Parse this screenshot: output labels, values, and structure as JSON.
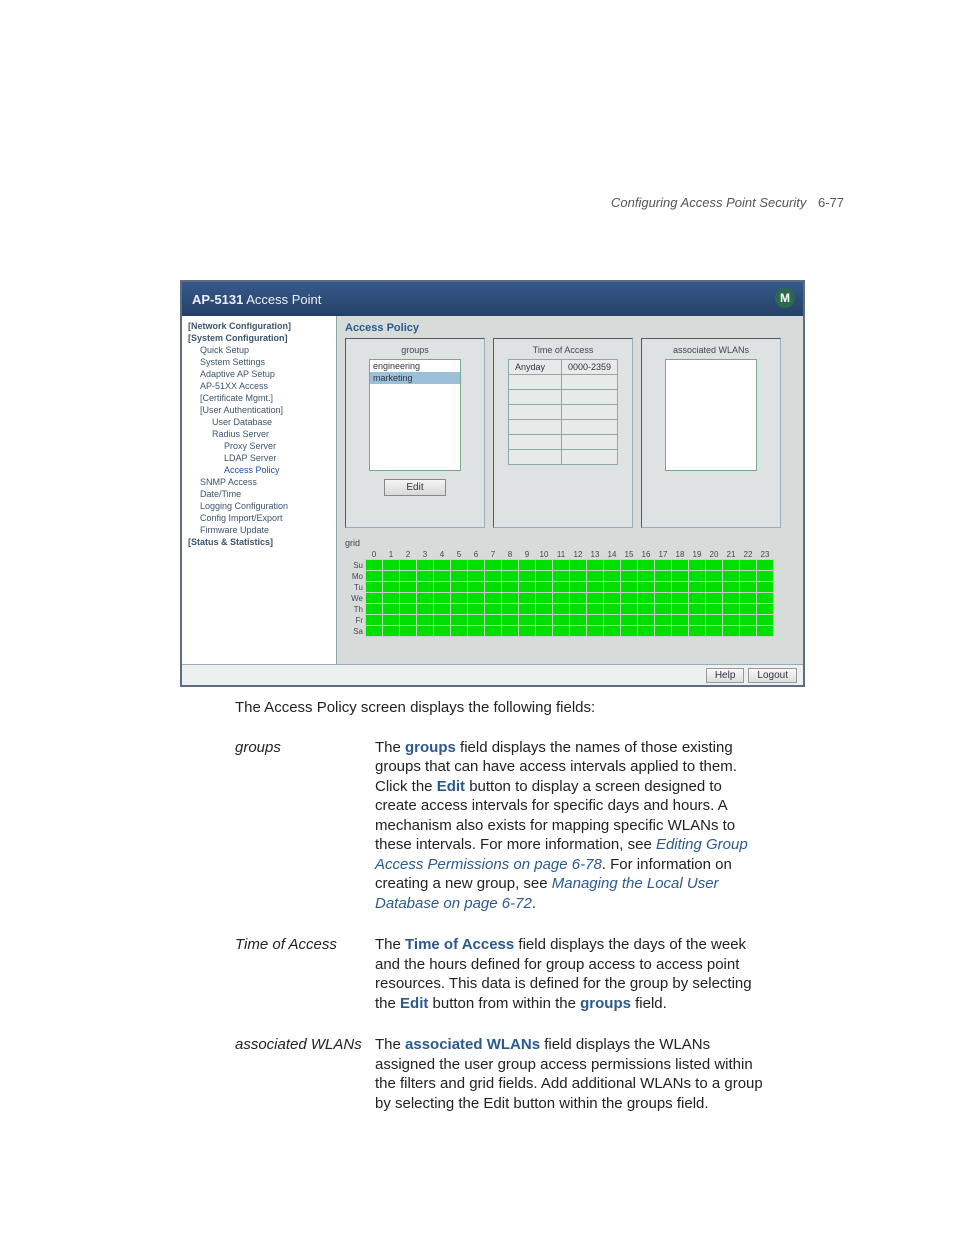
{
  "header": {
    "title": "Configuring Access Point Security",
    "page": "6-77"
  },
  "app": {
    "title_strong": "AP-5131",
    "title_rest": " Access Point",
    "logo_letter": "M",
    "nav": [
      {
        "label": "[Network Configuration]",
        "depth": 0
      },
      {
        "label": "[System Configuration]",
        "depth": 0
      },
      {
        "label": "Quick Setup",
        "depth": 1
      },
      {
        "label": "System Settings",
        "depth": 1
      },
      {
        "label": "Adaptive AP Setup",
        "depth": 1
      },
      {
        "label": "AP-51XX Access",
        "depth": 1
      },
      {
        "label": "[Certificate Mgmt.]",
        "depth": 1
      },
      {
        "label": "[User Authentication]",
        "depth": 1
      },
      {
        "label": "User Database",
        "depth": 2
      },
      {
        "label": "Radius Server",
        "depth": 2
      },
      {
        "label": "Proxy Server",
        "depth": 3
      },
      {
        "label": "LDAP Server",
        "depth": 3
      },
      {
        "label": "Access Policy",
        "depth": 3,
        "active": true
      },
      {
        "label": "SNMP Access",
        "depth": 1
      },
      {
        "label": "Date/Time",
        "depth": 1
      },
      {
        "label": "Logging Configuration",
        "depth": 1
      },
      {
        "label": "Config Import/Export",
        "depth": 1
      },
      {
        "label": "Firmware Update",
        "depth": 1
      },
      {
        "label": "[Status & Statistics]",
        "depth": 0
      }
    ],
    "main_title": "Access Policy",
    "panel_groups_label": "groups",
    "panel_time_label": "Time of Access",
    "panel_wlans_label": "associated WLANs",
    "groups_items": [
      "engineering",
      "marketing"
    ],
    "time_rows": [
      [
        "Anyday",
        "0000-2359"
      ],
      [
        "",
        ""
      ],
      [
        "",
        ""
      ],
      [
        "",
        ""
      ],
      [
        "",
        ""
      ],
      [
        "",
        ""
      ],
      [
        "",
        ""
      ]
    ],
    "edit_label": "Edit",
    "grid_label": "grid",
    "hours": [
      "0",
      "1",
      "2",
      "3",
      "4",
      "5",
      "6",
      "7",
      "8",
      "9",
      "10",
      "11",
      "12",
      "13",
      "14",
      "15",
      "16",
      "17",
      "18",
      "19",
      "20",
      "21",
      "22",
      "23"
    ],
    "days": [
      "Su",
      "Mo",
      "Tu",
      "We",
      "Th",
      "Fr",
      "Sa"
    ],
    "help_label": "Help",
    "logout_label": "Logout"
  },
  "explain": {
    "caption": "The Access Policy screen displays the following fields:",
    "fields": [
      {
        "term": "groups",
        "kw1": "groups",
        "txt1": " field displays the names of those existing groups that can have access intervals applied to them. Click the ",
        "kw2": "Edit",
        "txt2": " button to display a screen designed to create access intervals for specific days and hours. A mechanism also exists for mapping specific WLANs to these intervals. For more information, see ",
        "ln1": "Editing Group Access Permissions on page 6-78",
        "txt3": ". For information on creating a new group, see ",
        "ln2": "Managing the Local User Database on page 6-72",
        "txt4": "."
      },
      {
        "term": "Time of Access",
        "kw1": "Time of Access",
        "txt1": " field displays the days of the week and the hours defined for group access to access point resources. This data is defined for the group by selecting the ",
        "kw2": "Edit",
        "txt2": " button from within the ",
        "kw3": "groups",
        "txt3": " field."
      },
      {
        "term": "associated WLANs",
        "kw1": "associated WLANs",
        "txt1": " field displays the WLANs assigned the user group access permissions listed within the filters and grid fields. Add additional WLANs to a group by selecting the Edit button within the groups field."
      }
    ]
  }
}
